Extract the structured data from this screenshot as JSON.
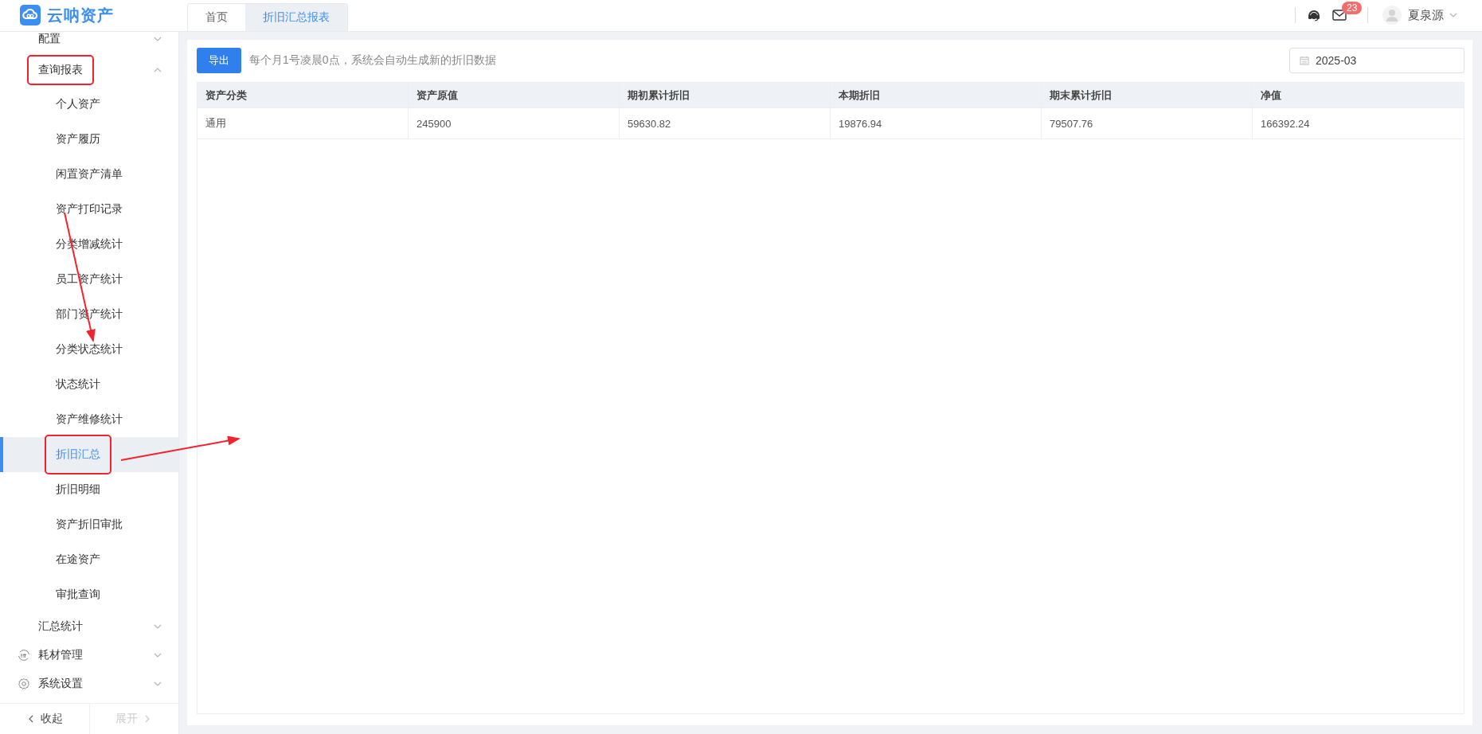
{
  "logo": {
    "text": "云呐资产"
  },
  "tabs": [
    {
      "label": "首页",
      "selected": false
    },
    {
      "label": "折旧汇总报表",
      "selected": true
    }
  ],
  "header": {
    "unread_count": "23",
    "user_name": "夏泉源"
  },
  "sidebar": {
    "items": [
      {
        "label": "配置",
        "expanded": false,
        "highlighted": false
      },
      {
        "label": "查询报表",
        "expanded": true,
        "highlighted": true,
        "children": [
          {
            "label": "个人资产",
            "selected": false,
            "highlighted": false
          },
          {
            "label": "资产履历",
            "selected": false,
            "highlighted": false
          },
          {
            "label": "闲置资产清单",
            "selected": false,
            "highlighted": false
          },
          {
            "label": "资产打印记录",
            "selected": false,
            "highlighted": false
          },
          {
            "label": "分类增减统计",
            "selected": false,
            "highlighted": false
          },
          {
            "label": "员工资产统计",
            "selected": false,
            "highlighted": false
          },
          {
            "label": "部门资产统计",
            "selected": false,
            "highlighted": false
          },
          {
            "label": "分类状态统计",
            "selected": false,
            "highlighted": false
          },
          {
            "label": "状态统计",
            "selected": false,
            "highlighted": false
          },
          {
            "label": "资产维修统计",
            "selected": false,
            "highlighted": false
          },
          {
            "label": "折旧汇总",
            "selected": true,
            "highlighted": true
          },
          {
            "label": "折旧明细",
            "selected": false,
            "highlighted": false
          },
          {
            "label": "资产折旧审批",
            "selected": false,
            "highlighted": false
          },
          {
            "label": "在途资产",
            "selected": false,
            "highlighted": false
          },
          {
            "label": "审批查询",
            "selected": false,
            "highlighted": false
          }
        ]
      },
      {
        "label": "汇总统计",
        "expanded": false,
        "highlighted": false
      },
      {
        "label": "耗材管理",
        "expanded": false,
        "highlighted": false
      },
      {
        "label": "系统设置",
        "expanded": false,
        "highlighted": false
      }
    ],
    "collapse_label": "收起",
    "expand_label": "展开",
    "expand_disabled": true
  },
  "toolbar": {
    "export_label": "导出",
    "hint": "每个月1号凌晨0点，系统会自动生成新的折旧数据",
    "date_value": "2025-03"
  },
  "table": {
    "columns": [
      "资产分类",
      "资产原值",
      "期初累计折旧",
      "本期折旧",
      "期末累计折旧",
      "净值"
    ],
    "rows": [
      [
        "通用",
        "245900",
        "59630.82",
        "19876.94",
        "79507.76",
        "166392.24"
      ]
    ]
  }
}
